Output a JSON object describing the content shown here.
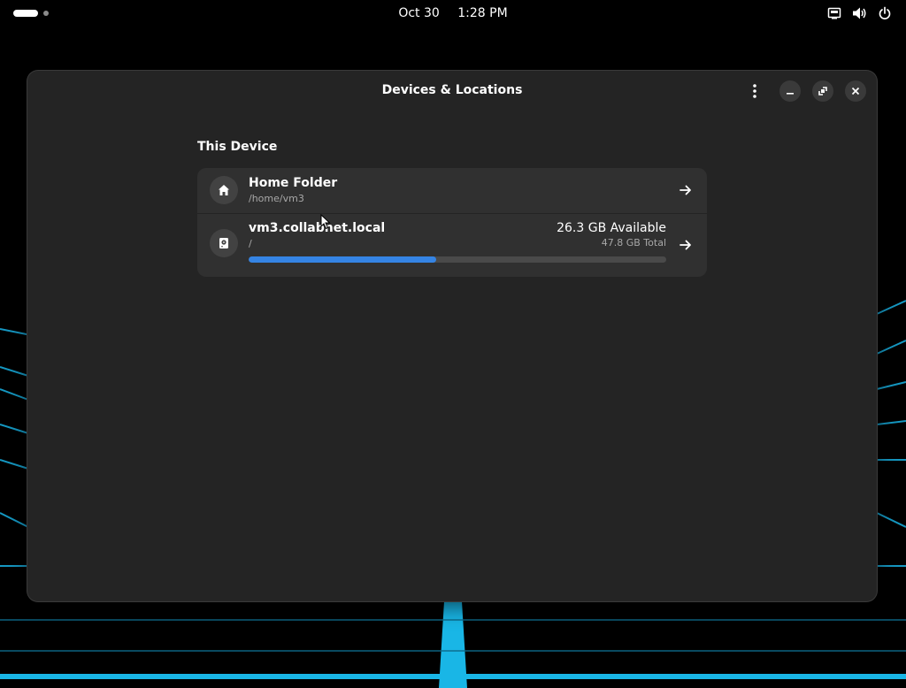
{
  "topbar": {
    "date": "Oct 30",
    "time": "1:28 PM",
    "tray_icons": [
      "network-icon",
      "volume-icon",
      "power-icon"
    ]
  },
  "window": {
    "title": "Devices & Locations",
    "section_title": "This Device",
    "locations": [
      {
        "name": "Home Folder",
        "path": "/home/vm3",
        "icon": "home-icon"
      },
      {
        "name": "vm3.collabnet.local",
        "path": "/",
        "icon": "drive-icon",
        "available": "26.3 GB Available",
        "total": "47.8 GB Total",
        "used_fraction": 0.45
      }
    ]
  },
  "colors": {
    "accent": "#3584e4",
    "window_bg": "#242424",
    "card_bg": "#303030",
    "wallpaper_glow": "#19b6e6"
  }
}
